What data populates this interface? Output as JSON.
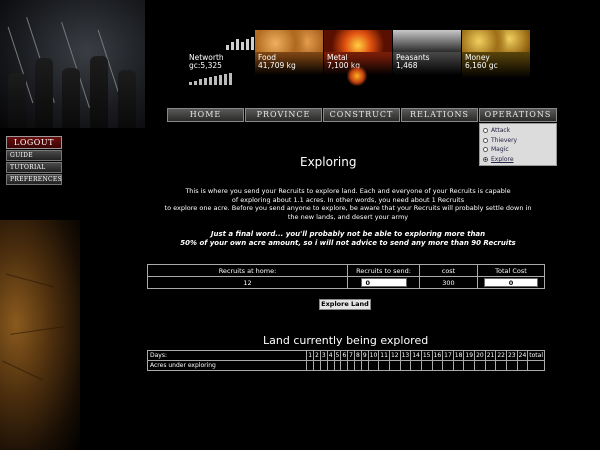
{
  "resources": [
    {
      "name": "Networth",
      "value": "gc:5,325",
      "pic": "bars"
    },
    {
      "name": "Food",
      "value": "41,709 kg",
      "pic": "bread"
    },
    {
      "name": "Metal",
      "value": "7,100 kg",
      "pic": "fire"
    },
    {
      "name": "Peasants",
      "value": "1,468",
      "pic": "peasants"
    },
    {
      "name": "Money",
      "value": "6,160 gc",
      "pic": "coins"
    }
  ],
  "left_menu": {
    "logout": "LOGOUT",
    "items": [
      "GUIDE",
      "TUTORIAL",
      "PREFERENCES"
    ]
  },
  "top_nav": [
    "HOME",
    "PROVINCE",
    "CONSTRUCT",
    "RELATIONS",
    "OPERATIONS"
  ],
  "operations_menu": {
    "options": [
      "Attack",
      "Thievery",
      "Magic",
      "Explore"
    ],
    "selected": "Explore"
  },
  "page": {
    "title": "Exploring",
    "intro_1": "This is where you send your Recruits to explore land. Each and everyone of your Recruits is capable",
    "intro_2": "of exploring about 1.1 acres. In other words, you need about 1 Recruits",
    "intro_3": "to explore one acre. Before you send anyone to explore, be aware that your Recruits will probably settle down in",
    "intro_4": "the new lands, and desert your army",
    "warn_1": "Just a final word... you'll probably not be able to exploring more than",
    "warn_2": "50% of your own acre amount, so i will not advice to send any more than 90 Recruits"
  },
  "form": {
    "headers": [
      "Recruits at home:",
      "Recruits to send:",
      "cost",
      "Total Cost"
    ],
    "recruits_at_home": "12",
    "recruits_to_send": "0",
    "cost": "300",
    "total_cost": "0",
    "submit_label": "Explore Land"
  },
  "exploring": {
    "title": "Land currently being explored",
    "row1_label": "Days:",
    "row2_label": "Acres under exploring",
    "days": [
      "1",
      "2",
      "3",
      "4",
      "5",
      "6",
      "7",
      "8",
      "9",
      "10",
      "11",
      "12",
      "13",
      "14",
      "15",
      "16",
      "17",
      "18",
      "19",
      "20",
      "21",
      "22",
      "23",
      "24",
      "total"
    ]
  },
  "colors": {
    "logout_red": "#6b0e0e",
    "menu_bg": "#dcdcdc"
  }
}
